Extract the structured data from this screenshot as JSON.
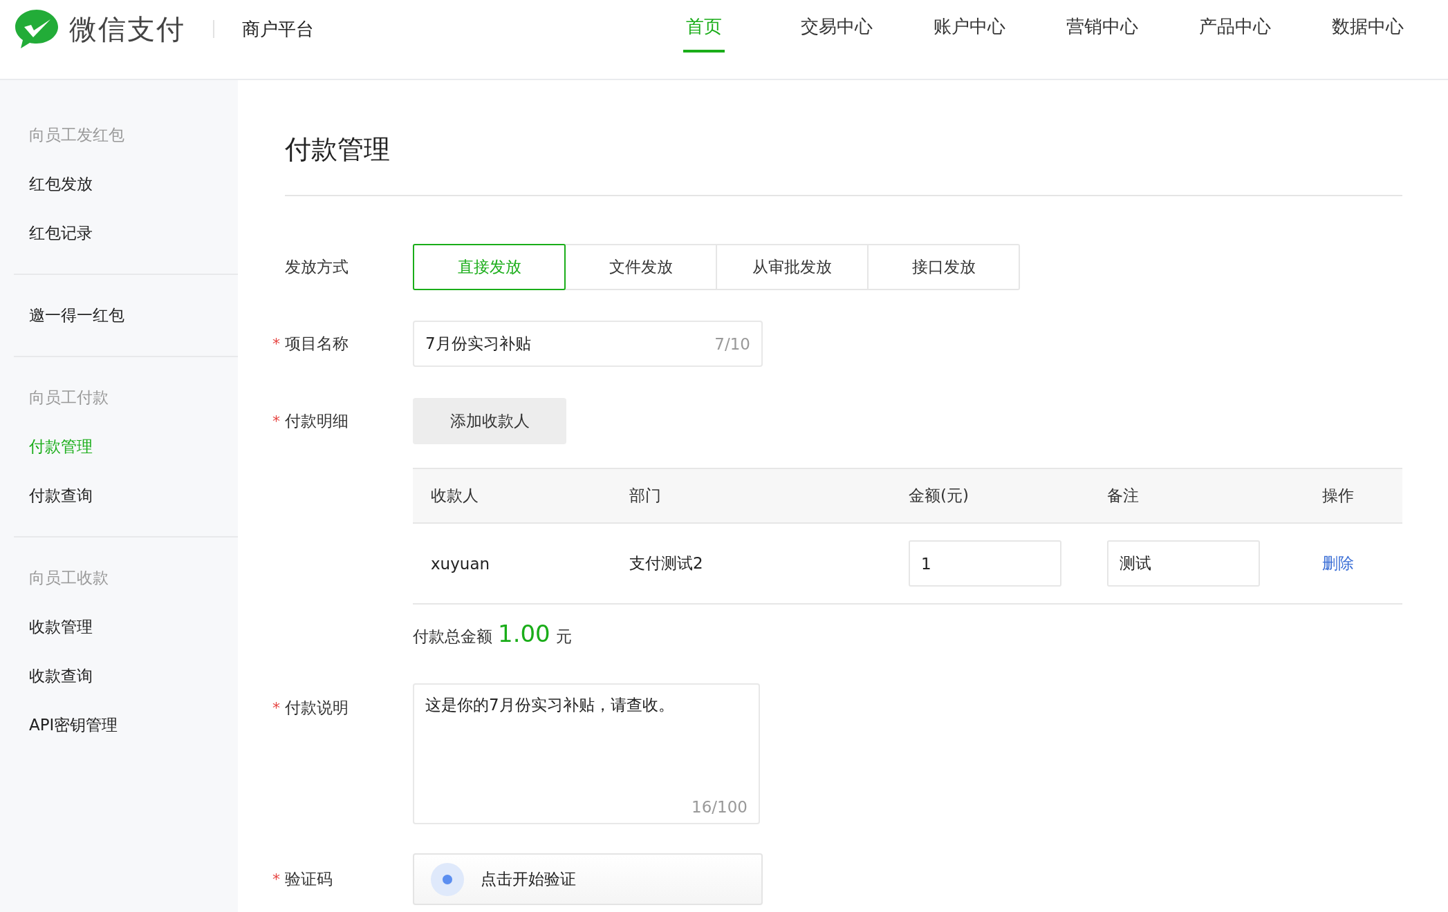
{
  "header": {
    "logo_text": "微信支付",
    "platform": "商户平台",
    "nav": [
      {
        "label": "首页",
        "selected": true
      },
      {
        "label": "交易中心",
        "selected": false
      },
      {
        "label": "账户中心",
        "selected": false
      },
      {
        "label": "营销中心",
        "selected": false
      },
      {
        "label": "产品中心",
        "selected": false
      },
      {
        "label": "数据中心",
        "selected": false
      }
    ]
  },
  "sidebar": {
    "groups": [
      {
        "title": "向员工发红包",
        "items": [
          {
            "label": "红包发放",
            "selected": false
          },
          {
            "label": "红包记录",
            "selected": false
          }
        ]
      },
      {
        "items": [
          {
            "label": "邀一得一红包",
            "selected": false
          }
        ]
      },
      {
        "title": "向员工付款",
        "items": [
          {
            "label": "付款管理",
            "selected": true
          },
          {
            "label": "付款查询",
            "selected": false
          }
        ]
      },
      {
        "title": "向员工收款",
        "items": [
          {
            "label": "收款管理",
            "selected": false
          },
          {
            "label": "收款查询",
            "selected": false
          },
          {
            "label": "API密钥管理",
            "selected": false
          }
        ]
      }
    ]
  },
  "page": {
    "title": "付款管理",
    "method": {
      "label": "发放方式",
      "options": [
        {
          "label": "直接发放",
          "selected": true
        },
        {
          "label": "文件发放",
          "selected": false
        },
        {
          "label": "从审批发放",
          "selected": false
        },
        {
          "label": "接口发放",
          "selected": false
        }
      ]
    },
    "project": {
      "mark": "*",
      "label": "项目名称",
      "value": "7月份实习补贴",
      "counter": "7/10"
    },
    "details": {
      "mark": "*",
      "label": "付款明细",
      "button": "添加收款人",
      "table": {
        "columns": [
          "收款人",
          "部门",
          "金额(元)",
          "备注",
          "操作"
        ],
        "rows": [
          {
            "payee": "xuyuan",
            "department": "支付测试2",
            "amount": "1",
            "note": "测试",
            "action": "删除"
          }
        ]
      },
      "total": {
        "label": "付款总金额",
        "amount": "1.00",
        "unit": "元"
      }
    },
    "description": {
      "mark": "*",
      "label": "付款说明",
      "value": "这是你的7月份实习补贴，请查收。",
      "counter": "16/100"
    },
    "captcha": {
      "mark": "*",
      "label": "验证码",
      "button": "点击开始验证"
    }
  }
}
